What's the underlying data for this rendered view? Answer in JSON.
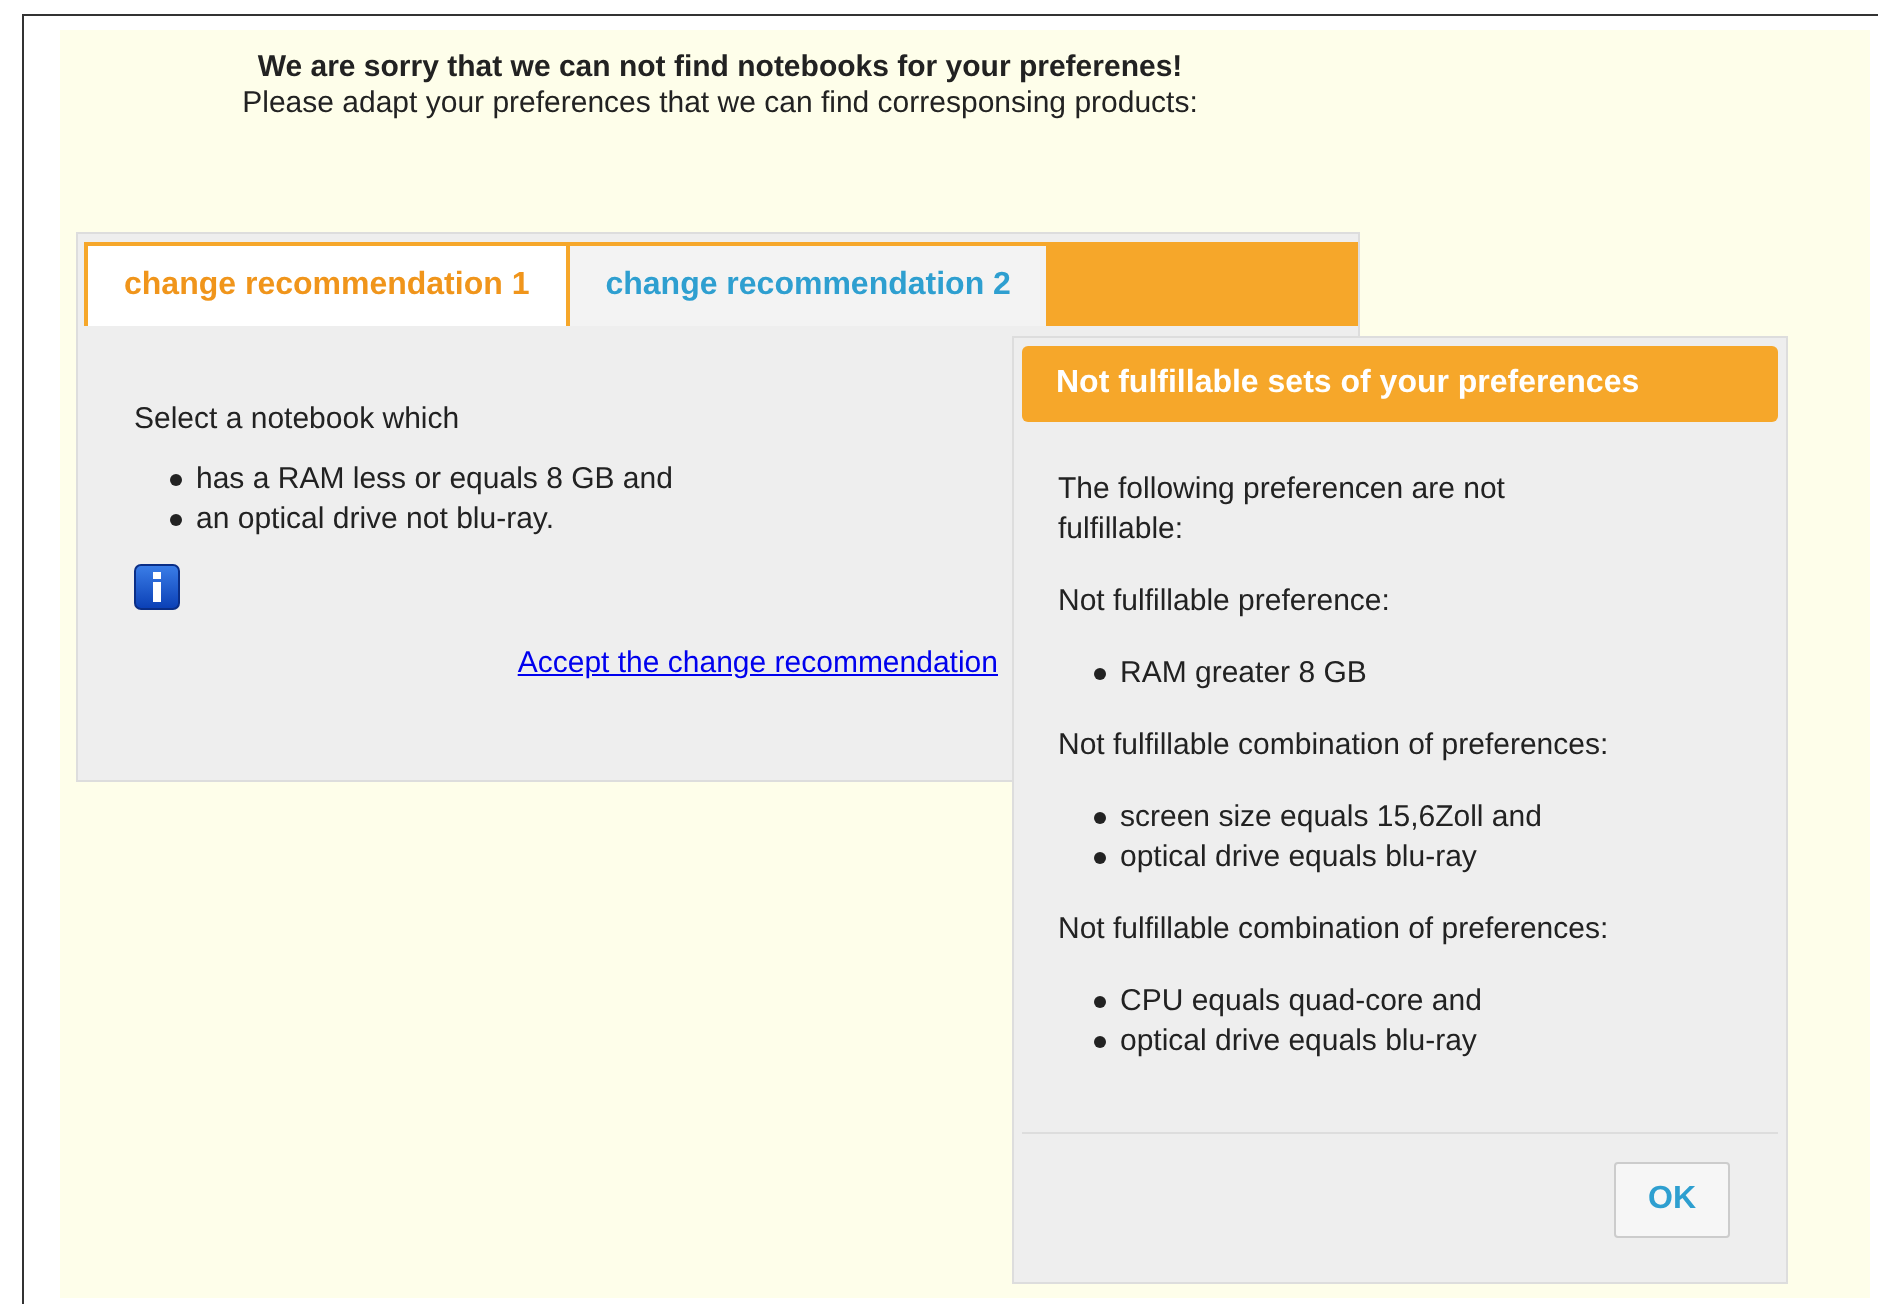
{
  "page": {
    "heading": "We are sorry that we can not find notebooks for your preferenes!",
    "subheading": "Please adapt your preferences that we can find corresponsing products:"
  },
  "tabs": [
    {
      "label": "change recommendation 1",
      "selected": true
    },
    {
      "label": "change recommendation 2",
      "selected": false
    }
  ],
  "panel": {
    "intro": "Select a notebook which",
    "items": [
      "has a RAM less or equals 8 GB and",
      "an optical drive not blu-ray."
    ],
    "link": "Accept the change recommendation"
  },
  "dialog": {
    "title": "Not fulfillable sets of your preferences",
    "intro": "The following preferencen are not fulfillable:",
    "groups": [
      {
        "heading": "Not fulfillable preference:",
        "items": [
          "RAM greater 8 GB"
        ]
      },
      {
        "heading": "Not fulfillable combination of preferences:",
        "items": [
          "screen size equals 15,6Zoll and",
          "optical drive equals blu-ray"
        ]
      },
      {
        "heading": "Not fulfillable combination of preferences:",
        "items": [
          "CPU equals quad-core and",
          "optical drive equals blu-ray"
        ]
      }
    ],
    "buttons": [
      "OK"
    ]
  }
}
